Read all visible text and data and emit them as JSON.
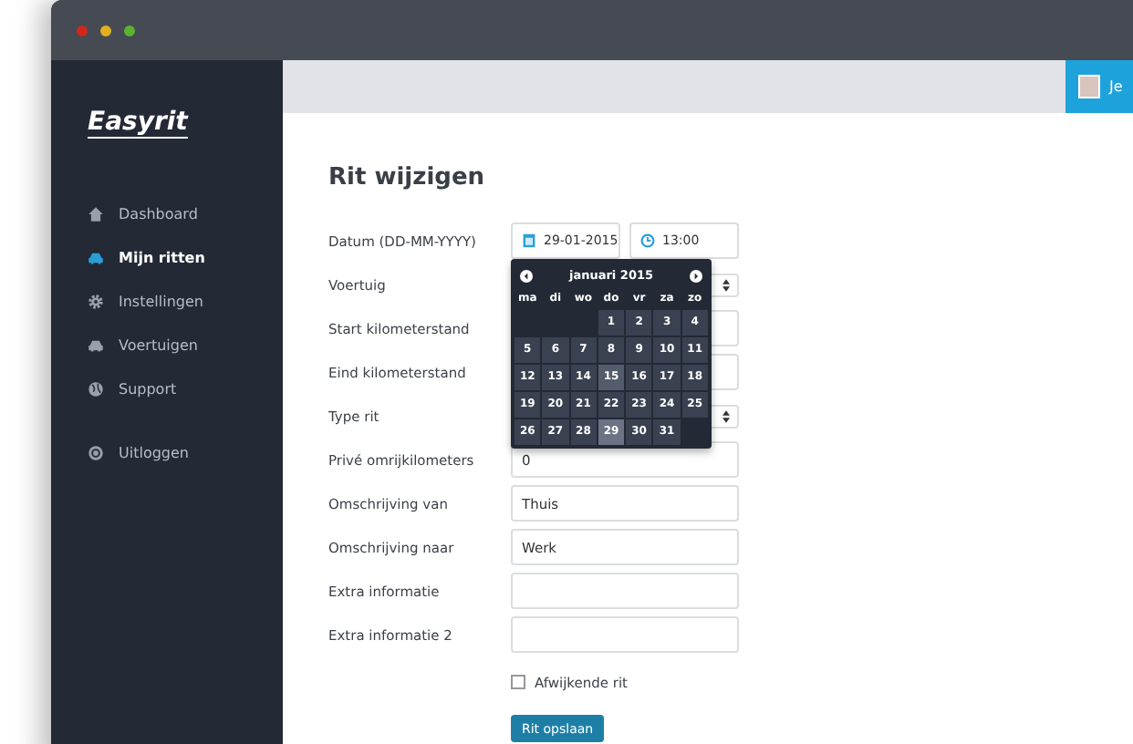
{
  "app": {
    "logo": "Easyrit"
  },
  "sidebar": {
    "items": [
      {
        "label": "Dashboard",
        "selected": false
      },
      {
        "label": "Mijn ritten",
        "selected": true
      },
      {
        "label": "Instellingen",
        "selected": false
      },
      {
        "label": "Voertuigen",
        "selected": false
      },
      {
        "label": "Support",
        "selected": false
      }
    ],
    "logout": {
      "label": "Uitloggen"
    }
  },
  "header": {
    "user": "Je"
  },
  "page": {
    "title": "Rit wijzigen"
  },
  "form": {
    "rows": [
      {
        "label": "Datum (DD-MM-YYYY)",
        "kind": "datetime",
        "date": "29-01-2015",
        "time": "13:00"
      },
      {
        "label": "Voertuig",
        "kind": "select"
      },
      {
        "label": "Start kilometerstand",
        "kind": "text"
      },
      {
        "label": "Eind kilometerstand",
        "kind": "text"
      },
      {
        "label": "Type rit",
        "kind": "select"
      },
      {
        "label": "Privé omrijkilometers",
        "kind": "text",
        "value": "0"
      },
      {
        "label": "Omschrijving van",
        "kind": "text",
        "value": "Thuis"
      },
      {
        "label": "Omschrijving naar",
        "kind": "text",
        "value": "Werk"
      },
      {
        "label": "Extra informatie",
        "kind": "text"
      },
      {
        "label": "Extra informatie 2",
        "kind": "text"
      }
    ],
    "checkbox": {
      "label": "Afwijkende rit",
      "checked": false
    },
    "submit": "Rit opslaan"
  },
  "datepicker": {
    "month": "januari 2015",
    "weekdays": [
      "ma",
      "di",
      "wo",
      "do",
      "vr",
      "za",
      "zo"
    ],
    "weeks": [
      [
        {
          "kind": "empty"
        },
        {
          "kind": "empty"
        },
        {
          "kind": "empty"
        },
        {
          "kind": "day",
          "label": "1",
          "selected": false,
          "today": false
        },
        {
          "kind": "day",
          "label": "2",
          "selected": false,
          "today": false
        },
        {
          "kind": "day",
          "label": "3",
          "selected": false,
          "today": false
        },
        {
          "kind": "day",
          "label": "4",
          "selected": false,
          "today": false
        }
      ],
      [
        {
          "kind": "day",
          "label": "5",
          "selected": false,
          "today": false
        },
        {
          "kind": "day",
          "label": "6",
          "selected": false,
          "today": false
        },
        {
          "kind": "day",
          "label": "7",
          "selected": false,
          "today": false
        },
        {
          "kind": "day",
          "label": "8",
          "selected": false,
          "today": false
        },
        {
          "kind": "day",
          "label": "9",
          "selected": false,
          "today": false
        },
        {
          "kind": "day",
          "label": "10",
          "selected": false,
          "today": false
        },
        {
          "kind": "day",
          "label": "11",
          "selected": false,
          "today": false
        }
      ],
      [
        {
          "kind": "day",
          "label": "12",
          "selected": false,
          "today": false
        },
        {
          "kind": "day",
          "label": "13",
          "selected": false,
          "today": false
        },
        {
          "kind": "day",
          "label": "14",
          "selected": false,
          "today": false
        },
        {
          "kind": "day",
          "label": "15",
          "selected": false,
          "today": true
        },
        {
          "kind": "day",
          "label": "16",
          "selected": false,
          "today": false
        },
        {
          "kind": "day",
          "label": "17",
          "selected": false,
          "today": false
        },
        {
          "kind": "day",
          "label": "18",
          "selected": false,
          "today": false
        }
      ],
      [
        {
          "kind": "day",
          "label": "19",
          "selected": false,
          "today": false
        },
        {
          "kind": "day",
          "label": "20",
          "selected": false,
          "today": false
        },
        {
          "kind": "day",
          "label": "21",
          "selected": false,
          "today": false
        },
        {
          "kind": "day",
          "label": "22",
          "selected": false,
          "today": false
        },
        {
          "kind": "day",
          "label": "23",
          "selected": false,
          "today": false
        },
        {
          "kind": "day",
          "label": "24",
          "selected": false,
          "today": false
        },
        {
          "kind": "day",
          "label": "25",
          "selected": false,
          "today": false
        }
      ],
      [
        {
          "kind": "day",
          "label": "26",
          "selected": false,
          "today": false
        },
        {
          "kind": "day",
          "label": "27",
          "selected": false,
          "today": false
        },
        {
          "kind": "day",
          "label": "28",
          "selected": false,
          "today": false
        },
        {
          "kind": "day",
          "label": "29",
          "selected": true,
          "today": false
        },
        {
          "kind": "day",
          "label": "30",
          "selected": false,
          "today": false
        },
        {
          "kind": "day",
          "label": "31",
          "selected": false,
          "today": false
        },
        {
          "kind": "empty"
        }
      ]
    ]
  }
}
